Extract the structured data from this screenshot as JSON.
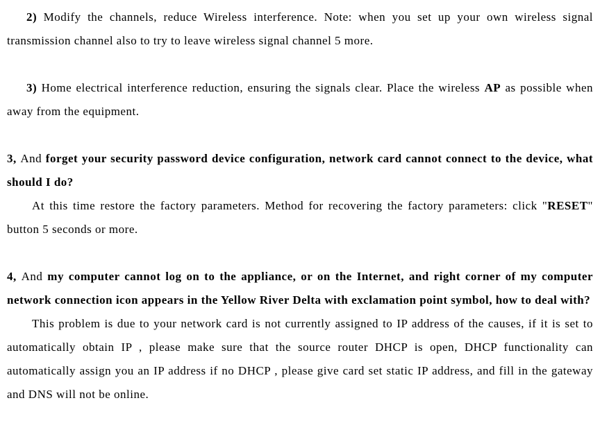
{
  "content": {
    "p1_prefix": "2)  ",
    "p1_text": "Modify the channels, reduce Wireless interference. Note: when you set up your own wireless signal transmission channel also to try to leave wireless signal channel 5 more.",
    "p2_prefix": "3)  ",
    "p2_text_a": "Home electrical interference reduction, ensuring the signals clear. Place the wireless ",
    "p2_bold1": "AP",
    "p2_text_b": " as possible when away from the equipment.",
    "p3_prefix": "3, ",
    "p3_text_a": "And ",
    "p3_bold": "forget your security password device configuration, network card cannot connect to the device, what should I do?",
    "p3b_text_a": "At this time restore the factory parameters. Method for recovering the factory parameters: click \"",
    "p3b_bold": "RESET",
    "p3b_text_b": "\" button 5 seconds or more.",
    "p4_prefix": "4, ",
    "p4_text_a": "And ",
    "p4_bold": "my computer cannot log on to the appliance, or on the Internet, and right corner of my computer network connection icon appears in the Yellow River Delta with exclamation point symbol, how to deal with?",
    "p4b_text": "This problem is due to your network card is not currently assigned to IP address of the causes, if it is set to automatically obtain IP , please make sure that the source router DHCP is open, DHCP functionality can automatically assign you an IP address if no DHCP , please give card set static IP address, and fill in the gateway and DNS will not be online."
  }
}
